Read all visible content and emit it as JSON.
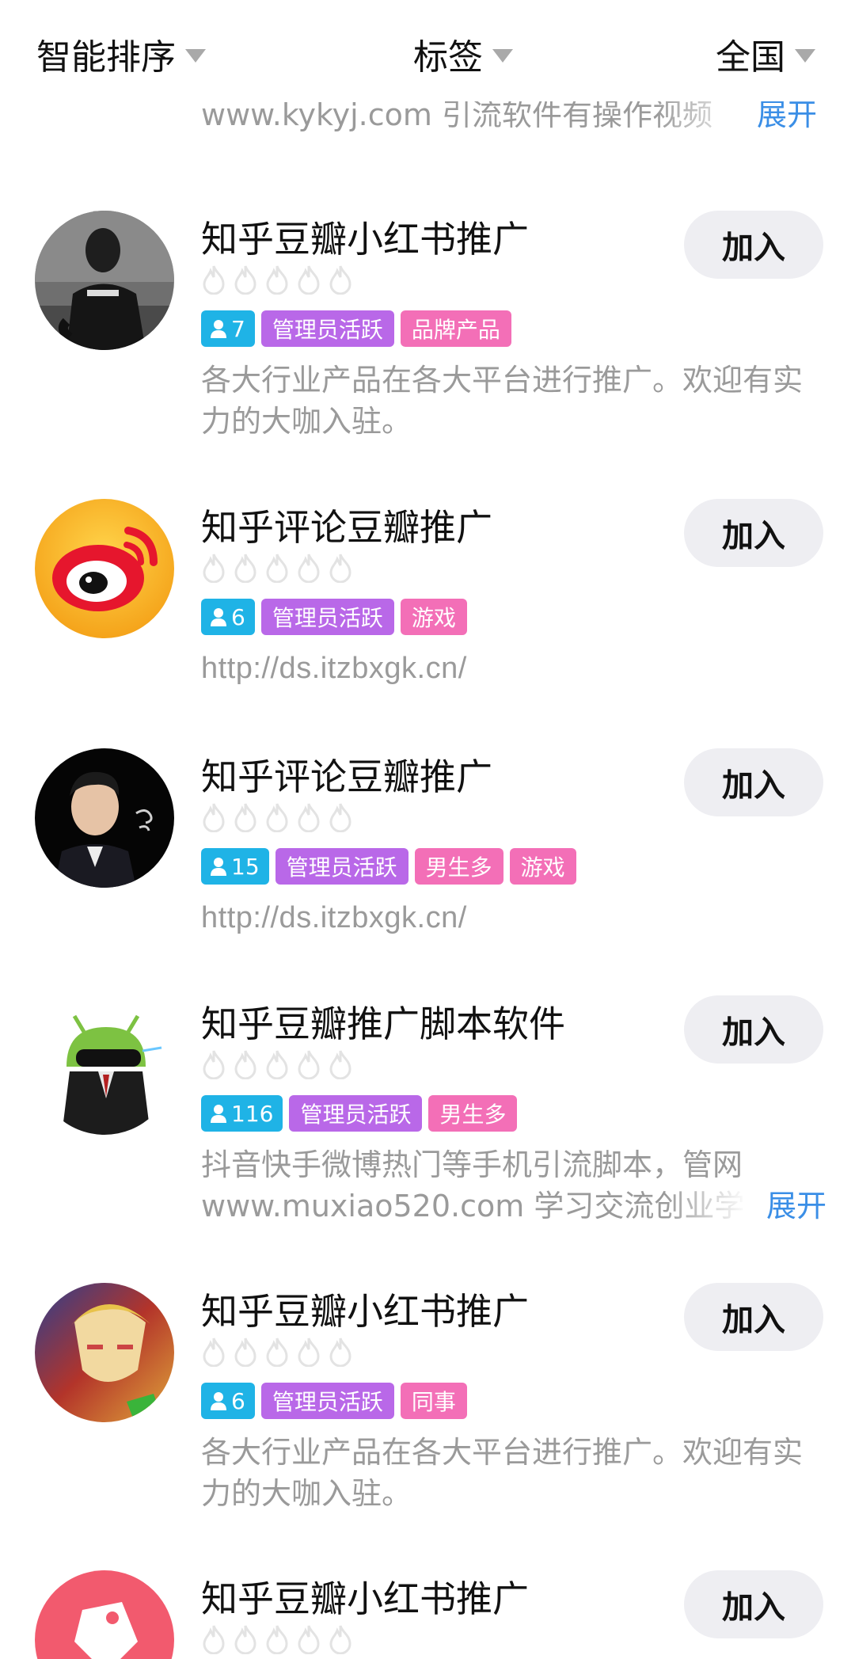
{
  "filters": [
    {
      "label": "智能排序"
    },
    {
      "label": "标签"
    },
    {
      "label": "全国"
    }
  ],
  "partial_item": {
    "description": "www.kykyj.com 引流软件有操作视频",
    "expand_label": "展开"
  },
  "groups": [
    {
      "title": "知乎豆瓣小红书推广",
      "join_label": "加入",
      "member_count": "7",
      "tags": [
        "管理员活跃",
        "品牌产品"
      ],
      "description": "各大行业产品在各大平台进行推广。欢迎有实力的大咖入驻。"
    },
    {
      "title": "知乎评论豆瓣推广",
      "join_label": "加入",
      "member_count": "6",
      "tags": [
        "管理员活跃",
        "游戏"
      ],
      "description": "http://ds.itzbxgk.cn/"
    },
    {
      "title": "知乎评论豆瓣推广",
      "join_label": "加入",
      "member_count": "15",
      "tags": [
        "管理员活跃",
        "男生多",
        "游戏"
      ],
      "description": "http://ds.itzbxgk.cn/"
    },
    {
      "title": "知乎豆瓣推广脚本软件",
      "join_label": "加入",
      "member_count": "116",
      "tags": [
        "管理员活跃",
        "男生多"
      ],
      "description_line1": "抖音快手微博热门等手机引流脚本，管网",
      "description_line2": "www.muxiao520.com 学习交流创业学",
      "expand_label": "展开"
    },
    {
      "title": "知乎豆瓣小红书推广",
      "join_label": "加入",
      "member_count": "6",
      "tags": [
        "管理员活跃",
        "同事"
      ],
      "description": "各大行业产品在各大平台进行推广。欢迎有实力的大咖入驻。"
    },
    {
      "title": "知乎豆瓣小红书推广",
      "join_label": "加入"
    }
  ],
  "colors": {
    "member_tag": "#1fb3e6",
    "admin_tag": "#b968e8",
    "category_tag": "#f36fb7",
    "expand_link": "#3a8ee6",
    "join_button_bg": "#eeeef2"
  }
}
